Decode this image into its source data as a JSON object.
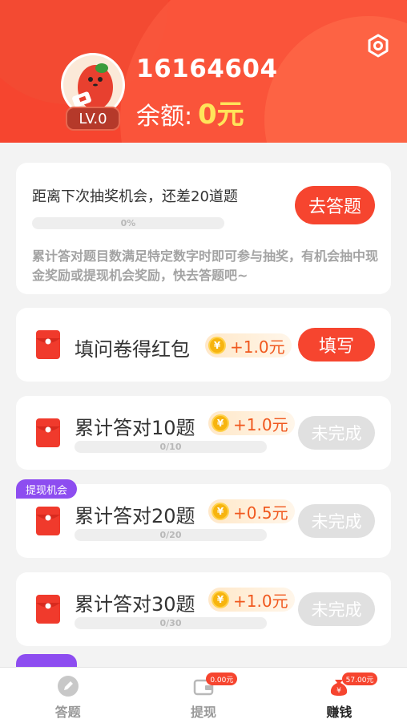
{
  "header": {
    "user_id": "16164604",
    "level": "LV.0",
    "balance_label": "余额:",
    "balance_value": "0元"
  },
  "lottery": {
    "title": "距离下次抽奖机会，还差20道题",
    "progress_text": "0%",
    "progress": 0,
    "button": "去答题",
    "description": "累计答对题目数满足特定数字时即可参与抽奖，有机会抽中现金奖励或提现机会奖励，快去答题吧~"
  },
  "tasks": [
    {
      "title": "填问卷得红包",
      "reward": "+1.0元",
      "button": "填写"
    },
    {
      "title": "累计答对10题",
      "reward": "+1.0元",
      "progress_text": "0/10",
      "progress": 0,
      "button": "未完成"
    },
    {
      "title": "累计答对20题",
      "reward": "+0.5元",
      "progress_text": "0/20",
      "progress": 0,
      "button": "未完成",
      "tag": "提现机会"
    },
    {
      "title": "累计答对30题",
      "reward": "+1.0元",
      "progress_text": "0/30",
      "progress": 0,
      "button": "未完成"
    }
  ],
  "coin_symbol": "¥",
  "nav": [
    {
      "label": "答题",
      "icon": "pencil-icon"
    },
    {
      "label": "提现",
      "icon": "wallet-icon",
      "badge": "0.00元"
    },
    {
      "label": "赚钱",
      "icon": "money-bag-icon",
      "badge": "57.00元",
      "active": true
    }
  ],
  "colors": {
    "primary": "#f6452f",
    "gold": "#ffe45a",
    "tag_purple": "#8d4df0"
  }
}
